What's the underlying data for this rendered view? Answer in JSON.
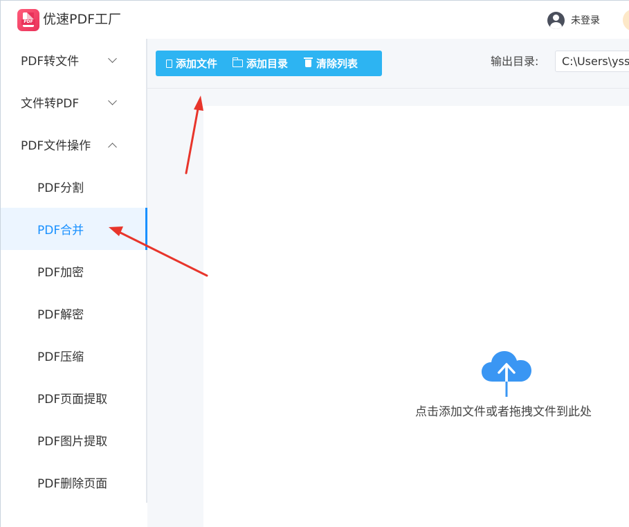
{
  "app": {
    "title": "优速PDF工厂",
    "logo_tag": "PDF",
    "user_label": "未登录"
  },
  "sidebar": {
    "items": [
      {
        "label": "PDF转文件",
        "expanded": false
      },
      {
        "label": "文件转PDF",
        "expanded": false
      },
      {
        "label": "PDF文件操作",
        "expanded": true
      },
      {
        "label": "PDF分割"
      },
      {
        "label": "PDF合并",
        "active": true
      },
      {
        "label": "PDF加密"
      },
      {
        "label": "PDF解密"
      },
      {
        "label": "PDF压缩"
      },
      {
        "label": "PDF页面提取"
      },
      {
        "label": "PDF图片提取"
      },
      {
        "label": "PDF删除页面"
      }
    ]
  },
  "toolbar": {
    "add_file": "添加文件",
    "add_dir": "添加目录",
    "clear_list": "清除列表",
    "output_label": "输出目录:",
    "output_value": "C:\\Users\\yss"
  },
  "dropzone": {
    "hint": "点击添加文件或者拖拽文件到此处",
    "icon": "cloud-upload-icon"
  },
  "colors": {
    "accent": "#1890ff",
    "toolbar_bg": "#2db4f2",
    "annotation_arrow": "#e8352b",
    "logo": "#e9325a"
  }
}
